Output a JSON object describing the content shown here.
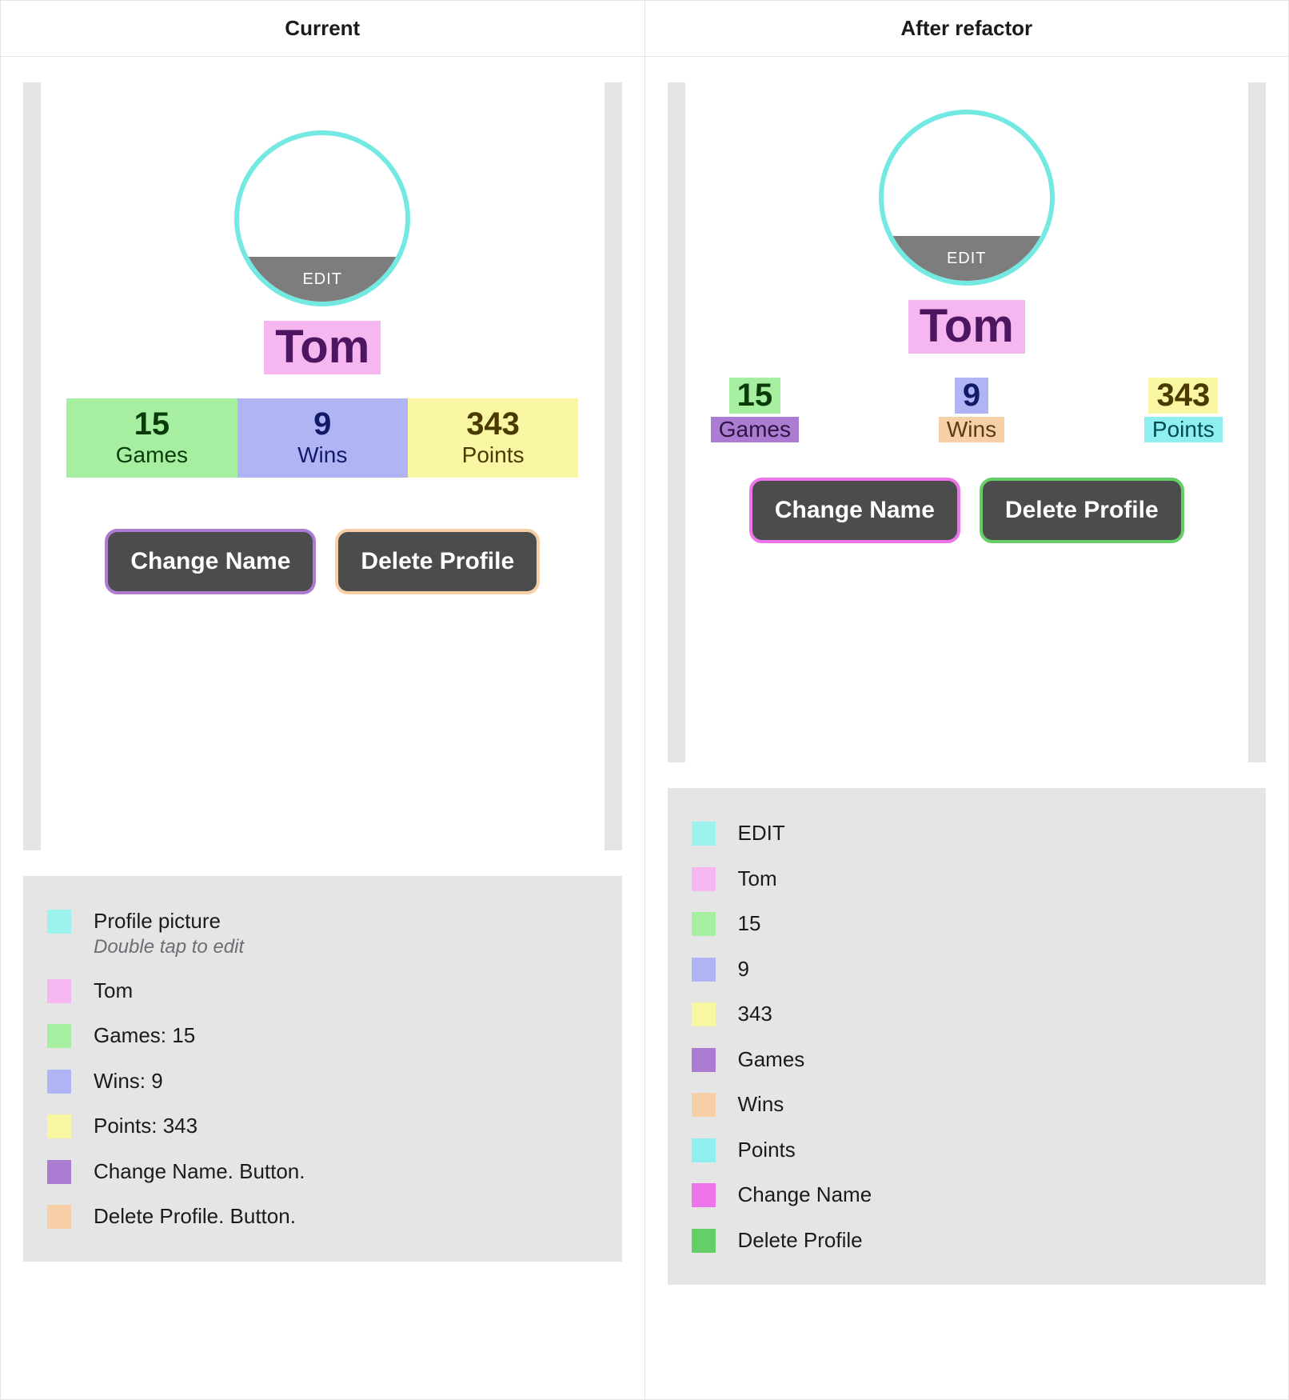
{
  "columns": {
    "current": {
      "title": "Current"
    },
    "after": {
      "title": "After refactor"
    }
  },
  "profile": {
    "edit_label": "EDIT",
    "name": "Tom",
    "stats": {
      "games": {
        "value": "15",
        "label": "Games"
      },
      "wins": {
        "value": "9",
        "label": "Wins"
      },
      "points": {
        "value": "343",
        "label": "Points"
      }
    },
    "buttons": {
      "change_name": "Change Name",
      "delete_profile": "Delete Profile"
    }
  },
  "legend_current": [
    {
      "swatch": "cyan",
      "text": "Profile picture",
      "sub": "Double tap to edit"
    },
    {
      "swatch": "pink",
      "text": "Tom"
    },
    {
      "swatch": "green",
      "text": "Games: 15"
    },
    {
      "swatch": "violet",
      "text": "Wins: 9"
    },
    {
      "swatch": "yellow",
      "text": "Points: 343"
    },
    {
      "swatch": "purple",
      "text": "Change Name. Button."
    },
    {
      "swatch": "peach",
      "text": "Delete Profile. Button."
    }
  ],
  "legend_after": [
    {
      "swatch": "cyan",
      "text": "EDIT"
    },
    {
      "swatch": "pink",
      "text": "Tom"
    },
    {
      "swatch": "green",
      "text": "15"
    },
    {
      "swatch": "violet",
      "text": "9"
    },
    {
      "swatch": "yellow",
      "text": "343"
    },
    {
      "swatch": "purple",
      "text": "Games"
    },
    {
      "swatch": "peach",
      "text": "Wins"
    },
    {
      "swatch": "cyan2",
      "text": "Points"
    },
    {
      "swatch": "magenta",
      "text": "Change Name"
    },
    {
      "swatch": "green2",
      "text": "Delete Profile"
    }
  ]
}
